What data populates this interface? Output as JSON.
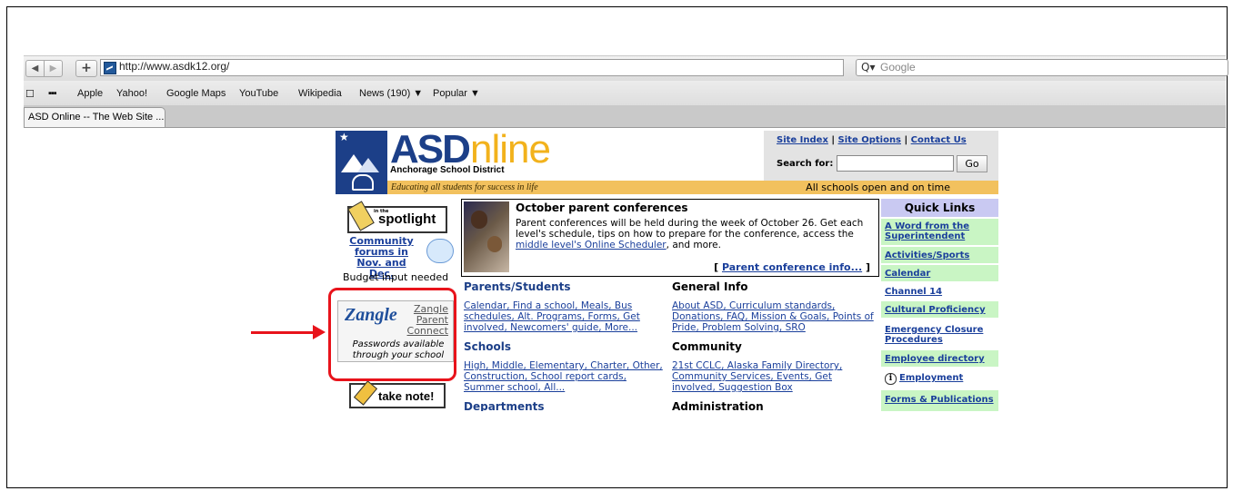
{
  "browser": {
    "back_icon": "◀",
    "forward_icon": "▶",
    "new_tab_label": "+",
    "url": "http://www.asdk12.org/",
    "reload_icon": "c",
    "search_icon": "Q▾",
    "search_placeholder": "Google",
    "bookmarks": [
      "Apple",
      "Yahoo!",
      "Google Maps",
      "YouTube",
      "Wikipedia",
      "News (190) ▼",
      "Popular ▼"
    ],
    "tab_title": "ASD Online -- The Web Site ..."
  },
  "site": {
    "logo_asd": "ASD",
    "logo_online": "nline",
    "district_name": "Anchorage School District",
    "tagline": "Educating all students for success in life",
    "status_message": "All schools open and on time",
    "top_links": [
      "Site Index",
      "Site Options",
      "Contact Us"
    ],
    "search_label": "Search for:",
    "search_value": "",
    "go_label": "Go",
    "spotlight_small": "in the",
    "spotlight_text": "spotlight",
    "community_link": "Community forums in Nov. and Dec.",
    "budget_text": "Budget input needed",
    "zangle_logo": "Zangle",
    "zangle_link": "Zangle Parent Connect",
    "zangle_note": "Passwords available through your school",
    "take_note": "take note!",
    "feature": {
      "title": "October parent conferences",
      "body_before": "Parent conferences will be held during the week of October 26. Get each level's schedule, tips on how to prepare for the conference, access the ",
      "body_link": "middle level's Online Scheduler",
      "body_after": ", and more.",
      "more_link": "Parent conference info..."
    },
    "sections": {
      "parents_head": "Parents/Students",
      "parents_links": "Calendar, Find a school, Meals, Bus schedules, Alt. Programs, Forms, Get involved, Newcomers' guide, More...",
      "schools_head": "Schools",
      "schools_links": "High, Middle, Elementary, Charter, Other, Construction, School report cards, Summer school, All...",
      "departments_head": "Departments",
      "general_head": "General Info",
      "general_links": "About ASD, Curriculum standards, Donations, FAQ, Mission & Goals, Points of Pride, Problem Solving, SRO",
      "community_head": "Community",
      "community_links": "21st CCLC, Alaska Family Directory, Community Services, Events, Get involved, Suggestion Box",
      "administration_head": "Administration"
    },
    "quick_links_title": "Quick Links",
    "quick_links": [
      "A Word from the Superintendent",
      "Activities/Sports",
      "Calendar",
      "Channel 14",
      "Cultural Proficiency",
      "Emergency Closure Procedures",
      "Employee directory",
      "Employment",
      "Forms & Publications"
    ],
    "employment_icon": "i"
  },
  "annotation_color": "#e8131b"
}
